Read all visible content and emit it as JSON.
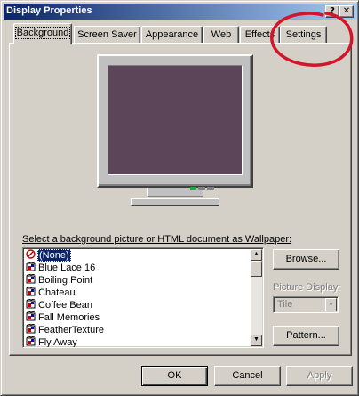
{
  "window": {
    "title": "Display Properties",
    "help_button": "?",
    "close_button": "✕"
  },
  "tabs": [
    {
      "label": "Background",
      "active": true
    },
    {
      "label": "Screen Saver",
      "active": false
    },
    {
      "label": "Appearance",
      "active": false
    },
    {
      "label": "Web",
      "active": false
    },
    {
      "label": "Effects",
      "active": false
    },
    {
      "label": "Settings",
      "active": false
    }
  ],
  "preview": {
    "screen_color": "#5d4559",
    "power_led_color": "#1fa83a"
  },
  "wallpaper": {
    "label": "Select a background picture or HTML document as Wallpaper:",
    "items": [
      {
        "label": "(None)",
        "icon": "none-icon",
        "selected": true
      },
      {
        "label": "Blue Lace 16",
        "icon": "bitmap-file-icon",
        "selected": false
      },
      {
        "label": "Boiling Point",
        "icon": "bitmap-file-icon",
        "selected": false
      },
      {
        "label": "Chateau",
        "icon": "bitmap-file-icon",
        "selected": false
      },
      {
        "label": "Coffee Bean",
        "icon": "bitmap-file-icon",
        "selected": false
      },
      {
        "label": "Fall Memories",
        "icon": "bitmap-file-icon",
        "selected": false
      },
      {
        "label": "FeatherTexture",
        "icon": "bitmap-file-icon",
        "selected": false
      },
      {
        "label": "Fly Away",
        "icon": "bitmap-file-icon",
        "selected": false
      }
    ]
  },
  "buttons": {
    "browse": "Browse...",
    "pattern": "Pattern...",
    "ok": "OK",
    "cancel": "Cancel",
    "apply": "Apply"
  },
  "picture_display": {
    "label": "Picture Display:",
    "value": "Tile",
    "enabled": false
  },
  "annotation": {
    "color": "#d4142a",
    "target": "Settings"
  },
  "colors": {
    "selection": "#0a246a",
    "face": "#d4d0c8"
  }
}
